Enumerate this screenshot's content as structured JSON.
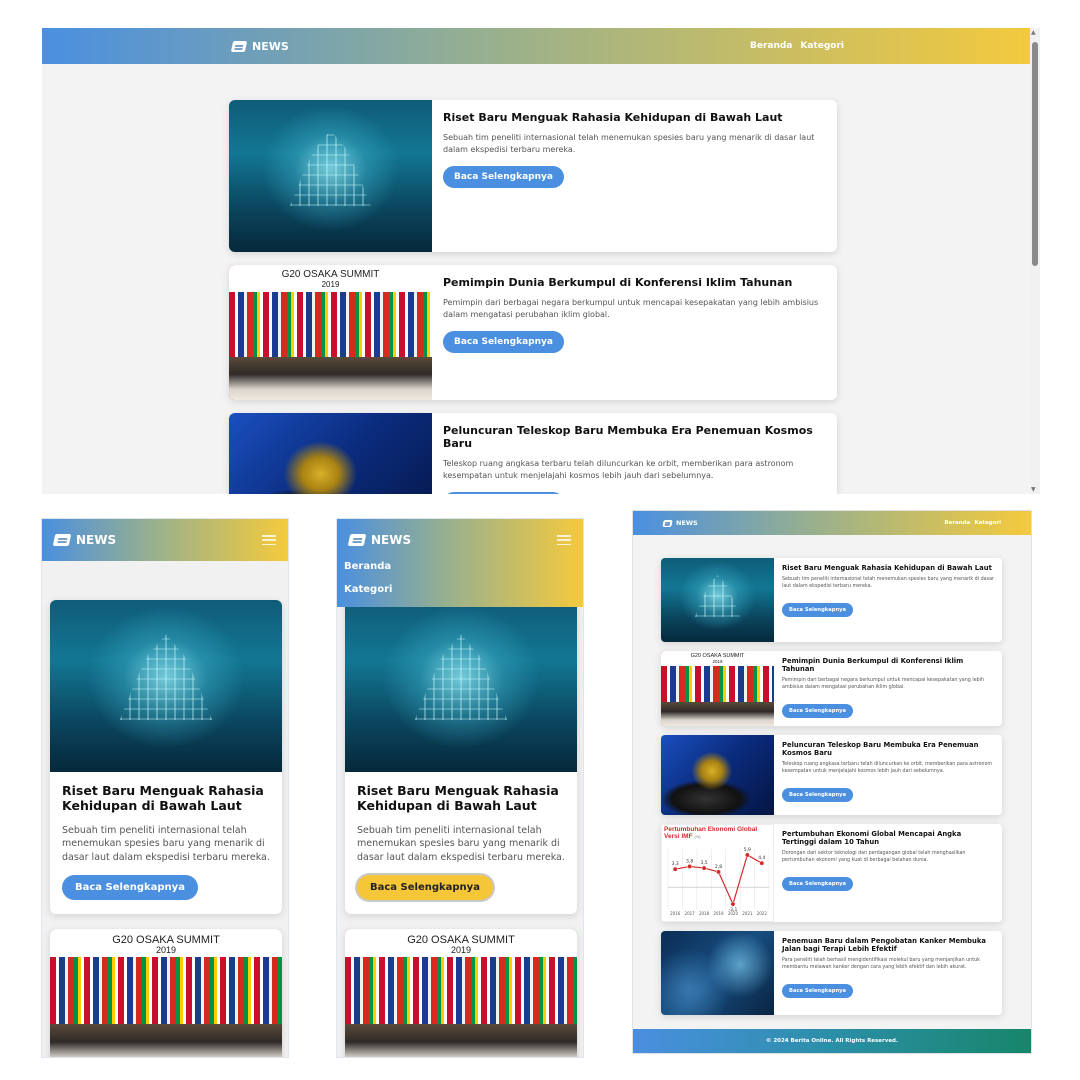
{
  "brand": {
    "name": "NEWS",
    "icon": "newspaper-icon"
  },
  "nav": {
    "links": [
      "Beranda",
      "Kategori"
    ],
    "menu_icon": "hamburger-menu-icon"
  },
  "colors": {
    "gradient_start": "#4a8fe0",
    "gradient_end": "#f5ca3c",
    "button": "#4a8fe0",
    "button_active": "#f5c638"
  },
  "articles": [
    {
      "title": "Riset Baru Menguak Rahasia Kehidupan di Bawah Laut",
      "summary": "Sebuah tim peneliti internasional telah menemukan spesies baru yang menarik di dasar laut dalam ekspedisi terbaru mereka.",
      "button": "Baca Selengkapnya"
    },
    {
      "title": "Pemimpin Dunia Berkumpul di Konferensi Iklim Tahunan",
      "summary": "Pemimpin dari berbagai negara berkumpul untuk mencapai kesepakatan yang lebih ambisius dalam mengatasi perubahan iklim global.",
      "button": "Baca Selengkapnya",
      "image_text": [
        "G20 OSAKA SUMMIT",
        "2019"
      ]
    },
    {
      "title": "Peluncuran Teleskop Baru Membuka Era Penemuan Kosmos Baru",
      "summary": "Teleskop ruang angkasa terbaru telah diluncurkan ke orbit, memberikan para astronom kesempatan untuk menjelajahi kosmos lebih jauh dari sebelumnya.",
      "button": "Baca Selengkapnya"
    },
    {
      "title": "Pertumbuhan Ekonomi Global Mencapai Angka Tertinggi dalam 10 Tahun",
      "summary": "Dorongan dari sektor teknologi dan perdagangan global telah menghasilkan pertumbuhan ekonomi yang kuat di berbagai belahan dunia.",
      "button": "Baca Selengkapnya",
      "image_title": [
        "Pertumbuhan Ekonomi Global",
        "Versi IMF"
      ],
      "image_unit": "(%)"
    },
    {
      "title": "Penemuan Baru dalam Pengobatan Kanker Membuka Jalan bagi Terapi Lebih Efektif",
      "summary": "Para peneliti telah berhasil mengidentifikasi molekul baru yang menjanjikan untuk membantu melawan kanker dengan cara yang lebih efektif dan lebih akurat.",
      "button": "Baca Selengkapnya"
    }
  ],
  "footer": {
    "text": "© 2024 Berita Online. All Rights Reserved."
  },
  "chart_data": {
    "type": "line",
    "title": "Pertumbuhan Ekonomi Global Versi IMF",
    "ylabel": "(%)",
    "categories": [
      "2016",
      "2017",
      "2018",
      "2019",
      "2020",
      "2021",
      "2022"
    ],
    "values": [
      3.3,
      3.8,
      3.5,
      2.8,
      -3.1,
      5.9,
      4.4
    ],
    "ylim": [
      -4,
      7
    ],
    "grid": true
  }
}
